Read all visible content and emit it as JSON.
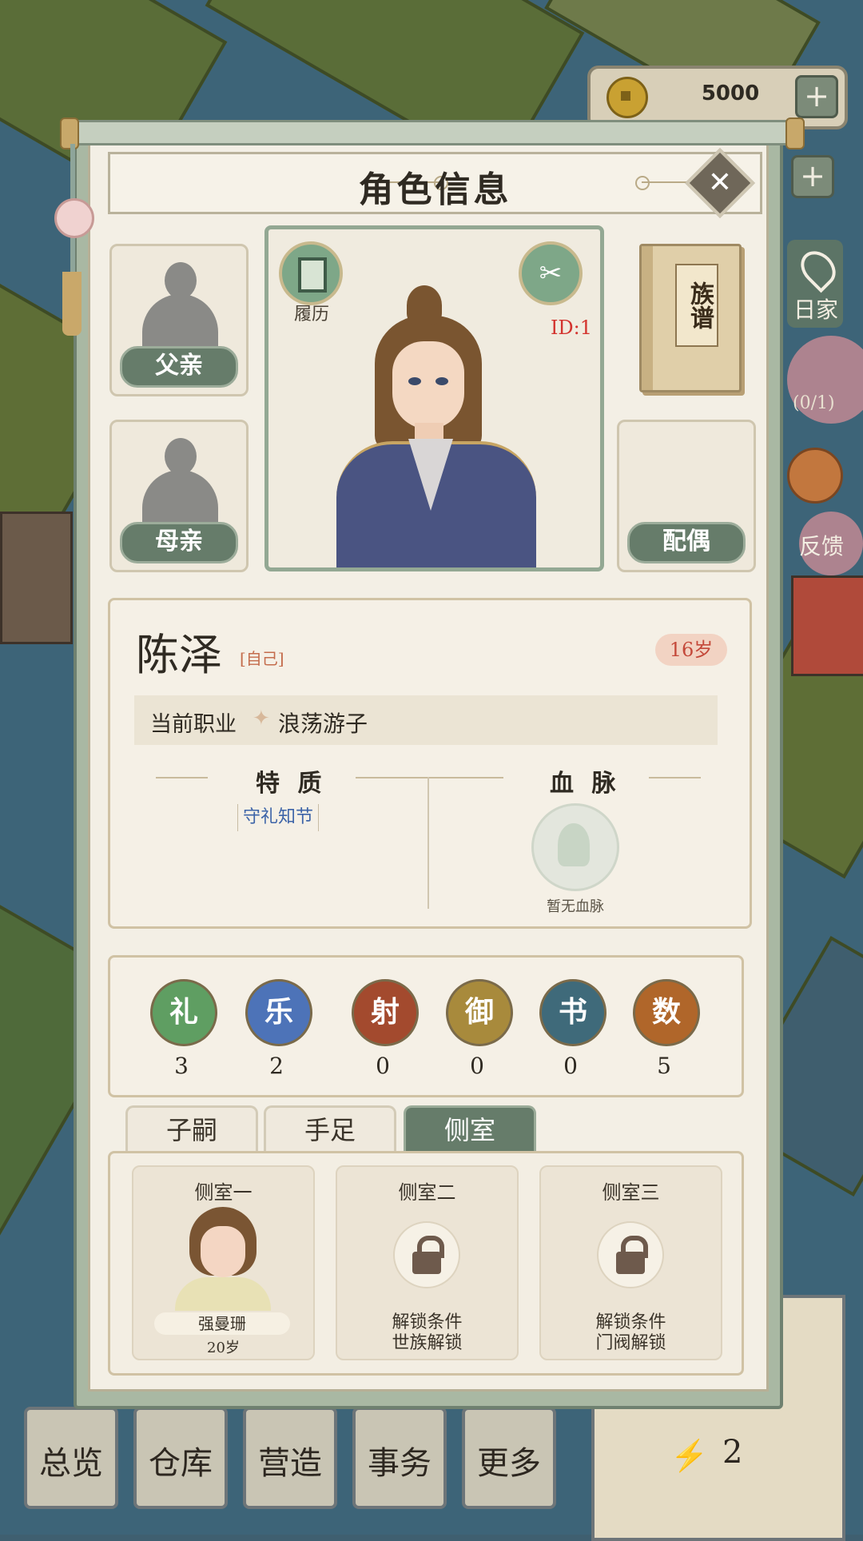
{
  "currency": {
    "coins": "5000",
    "plus_label": "+"
  },
  "side": {
    "home_label": "日家",
    "count_label": "(0/1)",
    "feedback_label": "反馈"
  },
  "bottom_nav": [
    "总览",
    "仓库",
    "营造",
    "事务",
    "更多"
  ],
  "resources": {
    "energy": "2"
  },
  "panel": {
    "title": "角色信息",
    "close_label": "✕",
    "resume_label": "履历",
    "id_label": "ID:1",
    "genealogy_label": "族谱",
    "father_label": "父亲",
    "mother_label": "母亲",
    "spouse_label": "配偶"
  },
  "character": {
    "name": "陈泽",
    "self_tag": "[自己]",
    "age": "16岁",
    "job_label": "当前职业",
    "job_value": "浪荡游子",
    "traits_header": "特 质",
    "bloodline_header": "血 脉",
    "traits": [
      "守礼知节"
    ],
    "no_bloodline": "暂无血脉"
  },
  "arts": [
    {
      "name": "礼",
      "value": "3",
      "color": "#5f9e62"
    },
    {
      "name": "乐",
      "value": "2",
      "color": "#4d73b8"
    },
    {
      "name": "射",
      "value": "0",
      "color": "#a34a2e"
    },
    {
      "name": "御",
      "value": "0",
      "color": "#a88a3c"
    },
    {
      "name": "书",
      "value": "0",
      "color": "#3f6a7a"
    },
    {
      "name": "数",
      "value": "5",
      "color": "#b0662a"
    }
  ],
  "tabs": [
    "子嗣",
    "手足",
    "侧室"
  ],
  "active_tab": "侧室",
  "concubines": [
    {
      "title": "侧室一",
      "name": "强曼珊",
      "age": "20岁"
    },
    {
      "title": "侧室二",
      "cond1": "解锁条件",
      "cond2": "世族解锁"
    },
    {
      "title": "侧室三",
      "cond1": "解锁条件",
      "cond2": "门阀解锁"
    }
  ]
}
